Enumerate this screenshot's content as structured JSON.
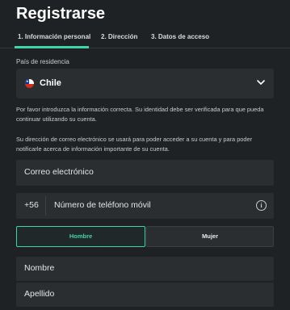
{
  "page": {
    "title": "Registrarse"
  },
  "tabs": [
    {
      "label": "1. Información personal"
    },
    {
      "label": "2. Dirección"
    },
    {
      "label": "3. Datos de acceso"
    }
  ],
  "country": {
    "label": "País de residencia",
    "value": "Chile",
    "flag_icon": "chile-flag-icon"
  },
  "info": {
    "p1": "Por favor introduzca la información correcta. Su identidad debe ser verificada para que pueda continuar utilizando su cuenta.",
    "p2": "Su dirección de correo electrónico se usará para poder acceder a su cuenta y para poder notificarle acerca de información importante de su cuenta."
  },
  "fields": {
    "email_placeholder": "Correo electrónico",
    "phone_prefix": "+56",
    "phone_placeholder": "Número de teléfono móvil",
    "first_name_placeholder": "Nombre",
    "last_name_placeholder": "Apellido"
  },
  "gender": {
    "male_label": "Hombre",
    "female_label": "Mujer",
    "selected": "Hombre"
  },
  "colors": {
    "accent": "#3fd6a7",
    "background": "#1f2224",
    "field": "#2a2e31"
  }
}
